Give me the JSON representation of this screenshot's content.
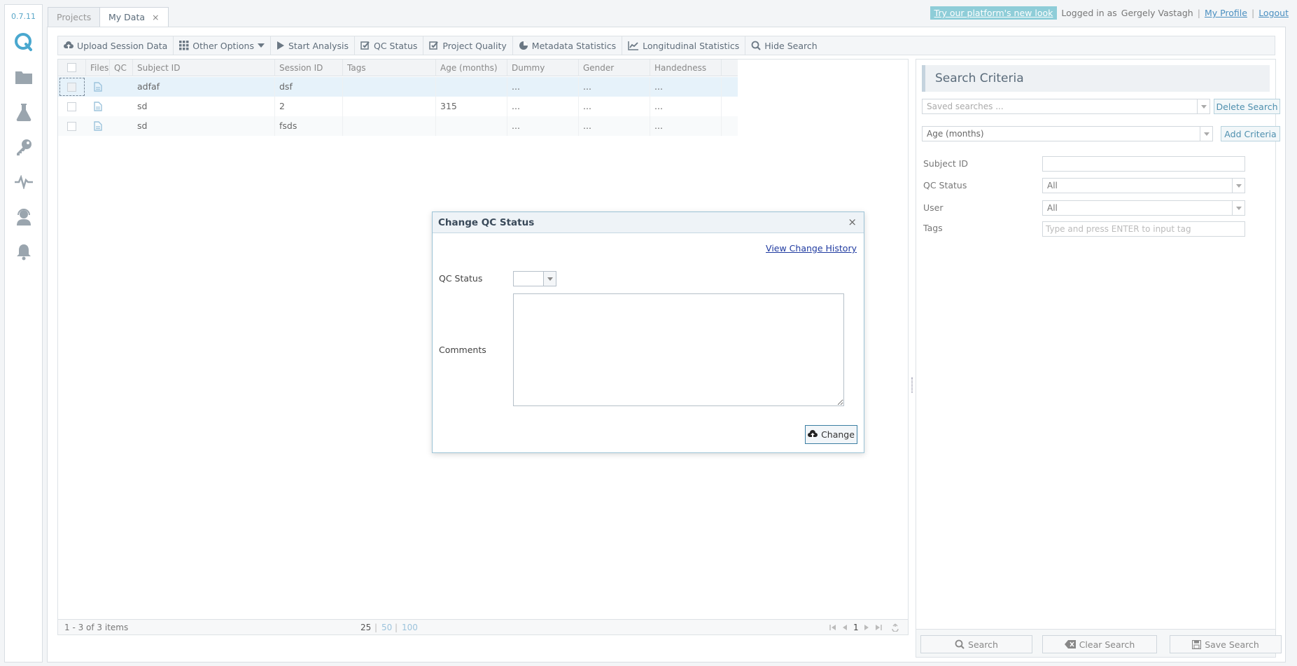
{
  "app": {
    "version": "0.7.11"
  },
  "nav": {
    "icons": [
      "q-logo-icon",
      "folder-icon",
      "flask-icon",
      "key-icon",
      "pulse-icon",
      "support-agent-icon",
      "bell-icon"
    ]
  },
  "tabs": [
    {
      "label": "Projects"
    },
    {
      "label": "My Data",
      "close": "×"
    }
  ],
  "header": {
    "new_look": "Try our platform's new look",
    "logged_in_as": "Logged in as",
    "user": "Gergely Vastagh",
    "sep": "|",
    "my_profile": "My Profile",
    "logout": "Logout"
  },
  "toolbar": {
    "upload": "Upload Session Data",
    "other_options": "Other Options",
    "start_analysis": "Start Analysis",
    "qc_status": "QC Status",
    "project_quality": "Project Quality",
    "metadata_statistics": "Metadata Statistics",
    "longitudinal_statistics": "Longitudinal Statistics",
    "hide_search": "Hide Search"
  },
  "grid": {
    "columns": [
      "Files",
      "QC",
      "Subject ID",
      "Session ID",
      "Tags",
      "Age (months)",
      "Dummy",
      "Gender",
      "Handedness"
    ],
    "rows": [
      {
        "subject": "adfaf",
        "session": "dsf",
        "tags": "",
        "age": "",
        "dummy": "...",
        "gender": "...",
        "hand": "..."
      },
      {
        "subject": "sd",
        "session": "2",
        "tags": "",
        "age": "315",
        "dummy": "...",
        "gender": "...",
        "hand": "..."
      },
      {
        "subject": "sd",
        "session": "fsds",
        "tags": "",
        "age": "",
        "dummy": "...",
        "gender": "...",
        "hand": "..."
      }
    ],
    "footer": {
      "range": "1 - 3 of 3 items",
      "page_size_25": "25",
      "page_size_50": "50",
      "page_size_100": "100",
      "sep": "|",
      "page": "1"
    }
  },
  "search": {
    "title": "Search Criteria",
    "saved_placeholder": "Saved searches ...",
    "delete_search": "Delete Search",
    "criteria_value": "Age (months)",
    "add_criteria": "Add Criteria",
    "subject_id_label": "Subject ID",
    "qc_status_label": "QC Status",
    "qc_status_value": "All",
    "user_label": "User",
    "user_value": "All",
    "tags_label": "Tags",
    "tags_placeholder": "Type and press ENTER to input tag",
    "search_btn": "Search",
    "clear_btn": "Clear Search",
    "save_btn": "Save Search"
  },
  "dialog": {
    "title": "Change QC Status",
    "close": "×",
    "view_history": "View Change History",
    "qc_status_label": "QC Status",
    "comments_label": "Comments",
    "change_btn": "Change"
  },
  "colors": {
    "accent": "#5aa7c8",
    "selected_row": "#e6f2fa",
    "link": "#1f3aa0"
  }
}
